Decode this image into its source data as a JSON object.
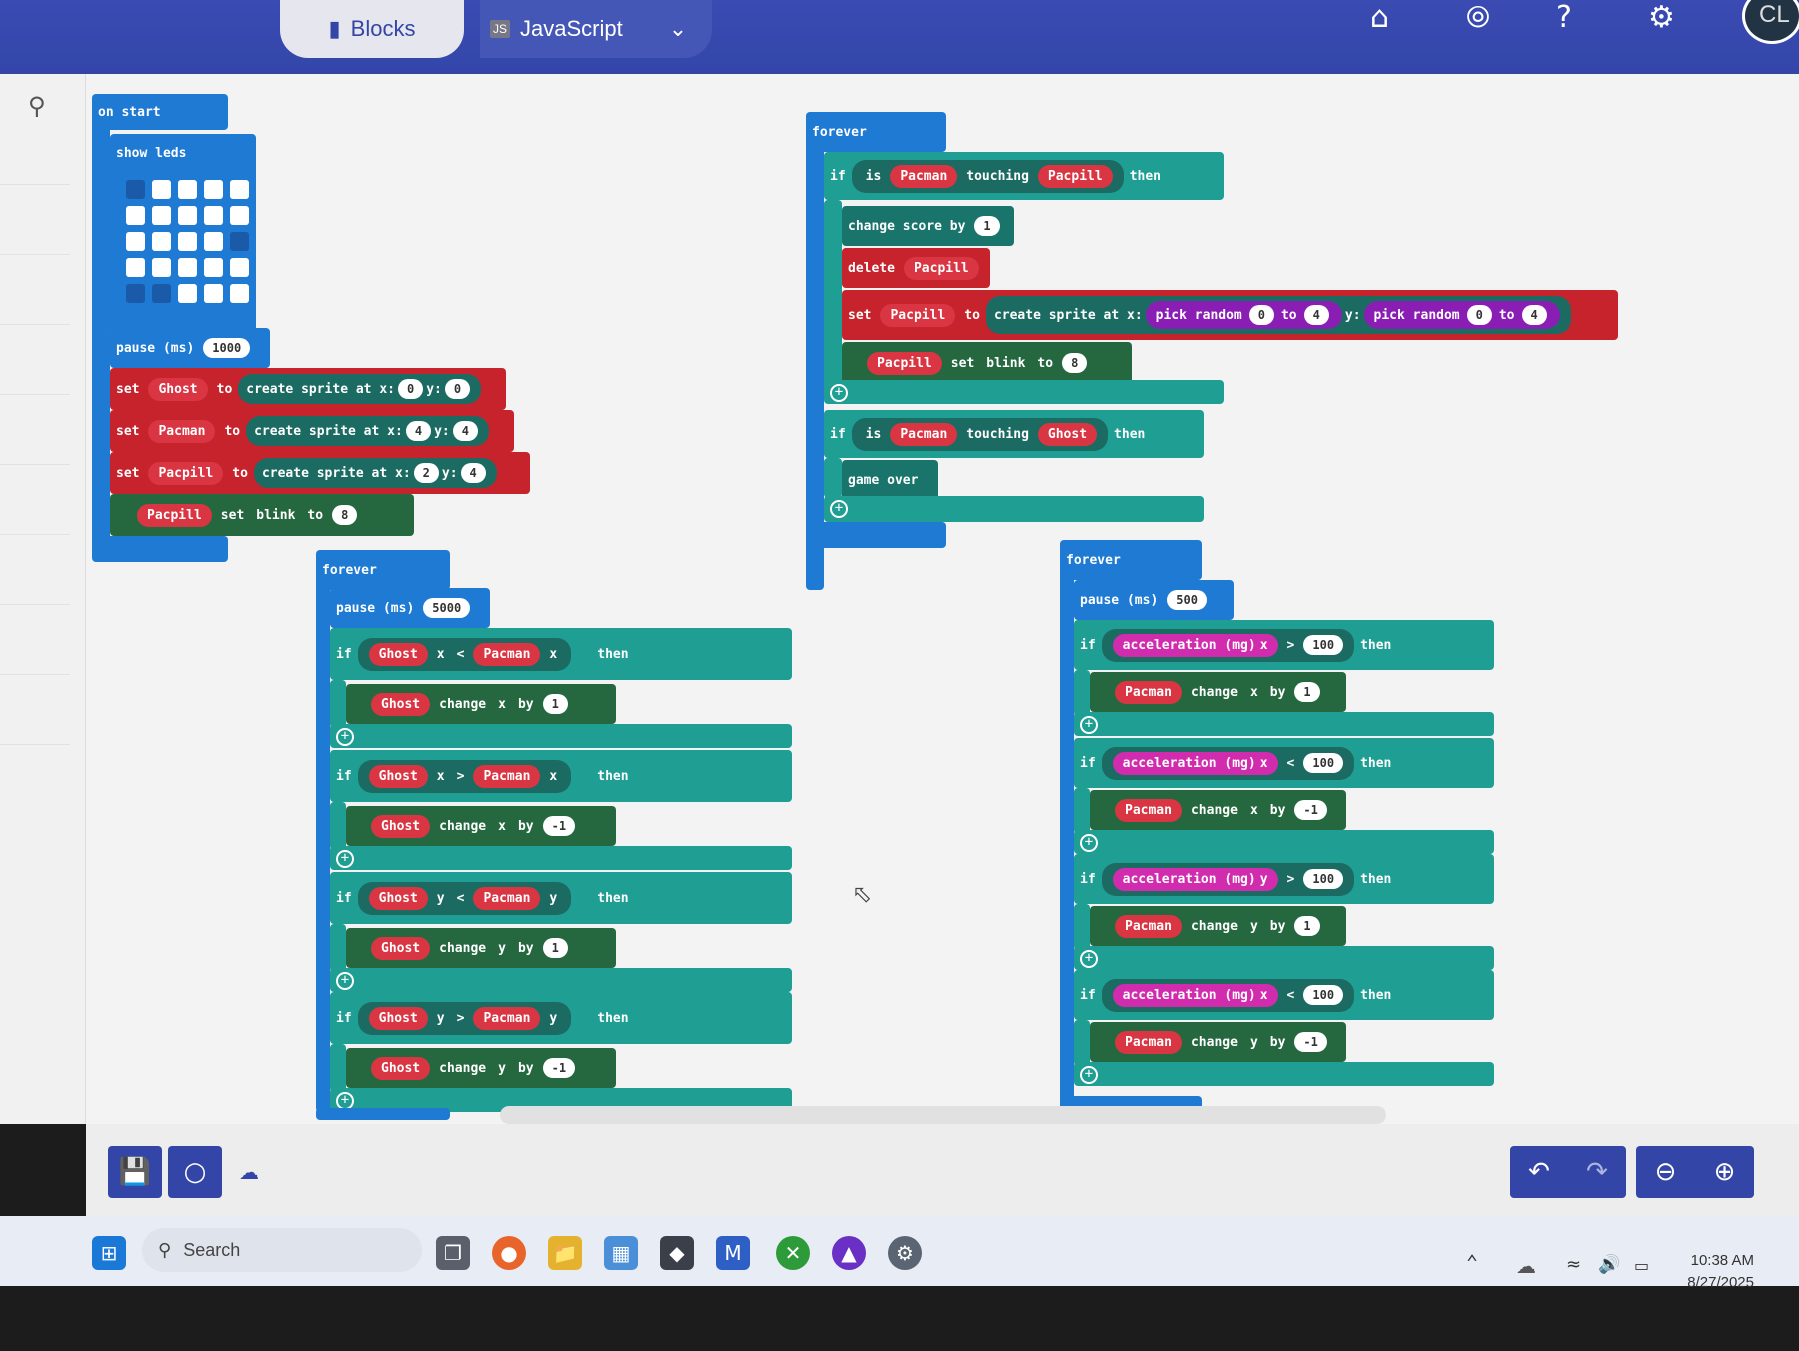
{
  "header": {
    "tab_blocks": "Blocks",
    "tab_js": "JavaScript",
    "js_badge": "JS",
    "avatar": "CL",
    "icons": [
      "home-icon",
      "share-icon",
      "help-icon",
      "gear-icon"
    ]
  },
  "on_start": {
    "title": "on start",
    "show_leds": "show leds",
    "leds": [
      [
        0,
        1,
        1,
        1,
        1
      ],
      [
        1,
        1,
        1,
        1,
        1
      ],
      [
        1,
        1,
        1,
        1,
        0
      ],
      [
        1,
        1,
        1,
        1,
        1
      ],
      [
        0,
        0,
        1,
        1,
        1
      ]
    ],
    "pause_label": "pause (ms)",
    "pause_val": "1000",
    "sets": [
      {
        "var": "Ghost",
        "x": "0",
        "y": "0"
      },
      {
        "var": "Pacman",
        "x": "4",
        "y": "4"
      },
      {
        "var": "Pacpill",
        "x": "2",
        "y": "4"
      }
    ],
    "blink": {
      "var": "Pacpill",
      "prop": "blink",
      "val": "8"
    }
  },
  "words": {
    "set": "set",
    "to": "to",
    "create": "create sprite at x:",
    "y": "y:",
    "if": "if",
    "then": "then",
    "change": "change",
    "by": "by",
    "forever": "forever",
    "is": "is",
    "touching": "touching",
    "pick": "pick random",
    "blink_set": "set",
    "accel": "acceleration (mg)"
  },
  "forever1": {
    "title": "forever",
    "a": "Pacman",
    "b": "Pacpill",
    "score": "change score by",
    "score_val": "1",
    "delete": "delete",
    "delete_var": "Pacpill",
    "set_var": "Pacpill",
    "r1a": "0",
    "r1b": "4",
    "r2a": "0",
    "r2b": "4",
    "blink_var": "Pacpill",
    "blink_prop": "blink",
    "blink_val": "8",
    "a2": "Pacman",
    "b2": "Ghost",
    "game_over": "game over"
  },
  "forever2": {
    "title": "forever",
    "pause_label": "pause (ms)",
    "pause_val": "5000",
    "rows": [
      {
        "l": "Ghost",
        "lp": "x",
        "op": "<",
        "r": "Pacman",
        "rp": "x",
        "axis": "x",
        "by": "1"
      },
      {
        "l": "Ghost",
        "lp": "x",
        "op": ">",
        "r": "Pacman",
        "rp": "x",
        "axis": "x",
        "by": "-1"
      },
      {
        "l": "Ghost",
        "lp": "y",
        "op": "<",
        "r": "Pacman",
        "rp": "y",
        "axis": "y",
        "by": "1"
      },
      {
        "l": "Ghost",
        "lp": "y",
        "op": ">",
        "r": "Pacman",
        "rp": "y",
        "axis": "y",
        "by": "-1"
      }
    ]
  },
  "forever3": {
    "title": "forever",
    "pause_label": "pause (ms)",
    "pause_val": "500",
    "rows": [
      {
        "ax": "x",
        "op": ">",
        "val": "100",
        "var": "Pacman",
        "axis": "x",
        "by": "1"
      },
      {
        "ax": "x",
        "op": "<",
        "val": "100",
        "var": "Pacman",
        "axis": "x",
        "by": "-1"
      },
      {
        "ax": "y",
        "op": ">",
        "val": "100",
        "var": "Pacman",
        "axis": "y",
        "by": "1"
      },
      {
        "ax": "x",
        "op": "<",
        "val": "100",
        "var": "Pacman",
        "axis": "y",
        "by": "-1"
      }
    ]
  },
  "taskbar": {
    "search": "Search",
    "time": "10:38 AM",
    "date": "8/27/2025"
  },
  "colors": {
    "topbar": "#3346a8",
    "blue_block": "#1e7ad2",
    "teal_block": "#1f9e94",
    "red_block": "#c7232c",
    "variable": "#d93542"
  }
}
